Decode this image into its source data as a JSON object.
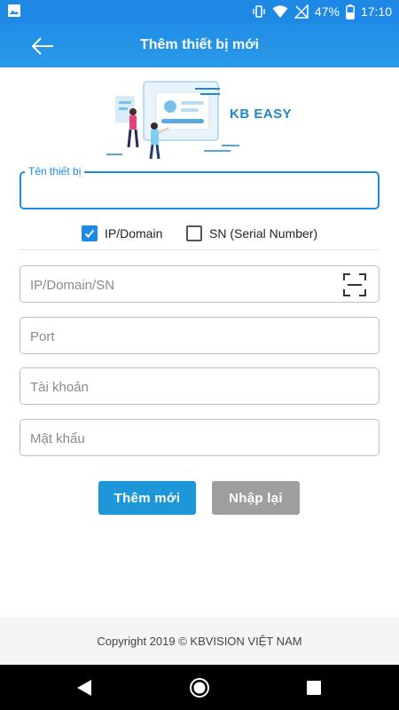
{
  "status_bar": {
    "battery": "47%",
    "time": "17:10",
    "icons": [
      "image-icon",
      "vibrate-icon",
      "wifi-icon",
      "no-signal-icon",
      "battery-icon"
    ]
  },
  "app_bar": {
    "title": "Thêm thiết bị mới",
    "back_icon": "arrow-left-icon"
  },
  "hero": {
    "brand": "KB EASY"
  },
  "form": {
    "device_name": {
      "label": "Tên thiết bị",
      "value": ""
    },
    "mode_options": [
      {
        "label": "IP/Domain",
        "checked": true
      },
      {
        "label": "SN (Serial Number)",
        "checked": false
      }
    ],
    "address": {
      "placeholder": "IP/Domain/SN",
      "icon": "qr-scan-icon"
    },
    "port": {
      "placeholder": "Port"
    },
    "account": {
      "placeholder": "Tài khoản"
    },
    "password": {
      "placeholder": "Mật khẩu"
    }
  },
  "buttons": {
    "add": "Thêm mới",
    "reset": "Nhập lại"
  },
  "footer": {
    "copyright": "Copyright 2019 © KBVISION VIỆT NAM"
  },
  "colors": {
    "primary": "#1e88e5",
    "button_add": "#1e97d9",
    "button_reset": "#9e9e9e"
  }
}
